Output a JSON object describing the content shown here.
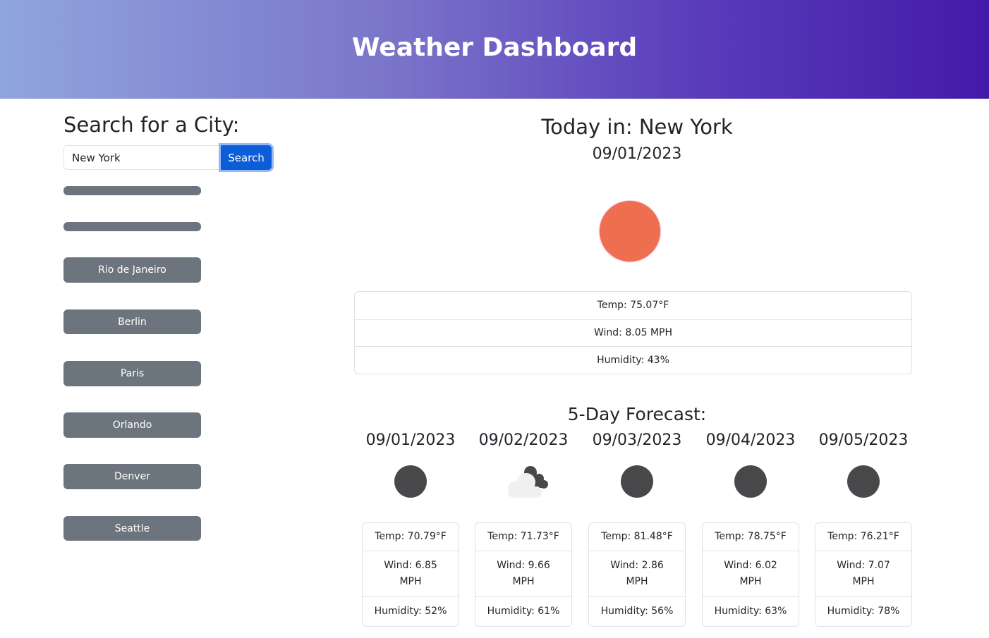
{
  "header": {
    "title": "Weather Dashboard"
  },
  "search": {
    "heading": "Search for a City:",
    "value": "New York",
    "button": "Search"
  },
  "history": [
    "Rio de Janeiro",
    "Berlin",
    "Paris",
    "Orlando",
    "Denver",
    "Seattle"
  ],
  "today": {
    "title": "Today in: New York",
    "date": "09/01/2023",
    "icon": "sun-icon",
    "temp": "Temp: 75.07°F",
    "wind": "Wind: 8.05 MPH",
    "humidity": "Humidity: 43%",
    "sun_color": "#ee6f4f"
  },
  "forecast": {
    "heading": "5-Day Forecast:",
    "days": [
      {
        "date": "09/01/2023",
        "icon": "moon-icon",
        "temp": "Temp: 70.79°F",
        "wind": "Wind: 6.85",
        "unit": "MPH",
        "humidity": "Humidity: 52%"
      },
      {
        "date": "09/02/2023",
        "icon": "cloud-night-icon",
        "temp": "Temp: 71.73°F",
        "wind": "Wind: 9.66",
        "unit": "MPH",
        "humidity": "Humidity: 61%"
      },
      {
        "date": "09/03/2023",
        "icon": "moon-icon",
        "temp": "Temp: 81.48°F",
        "wind": "Wind: 2.86",
        "unit": "MPH",
        "humidity": "Humidity: 56%"
      },
      {
        "date": "09/04/2023",
        "icon": "moon-icon",
        "temp": "Temp: 78.75°F",
        "wind": "Wind: 6.02",
        "unit": "MPH",
        "humidity": "Humidity: 63%"
      },
      {
        "date": "09/05/2023",
        "icon": "moon-icon",
        "temp": "Temp: 76.21°F",
        "wind": "Wind: 7.07",
        "unit": "MPH",
        "humidity": "Humidity: 78%"
      }
    ]
  }
}
